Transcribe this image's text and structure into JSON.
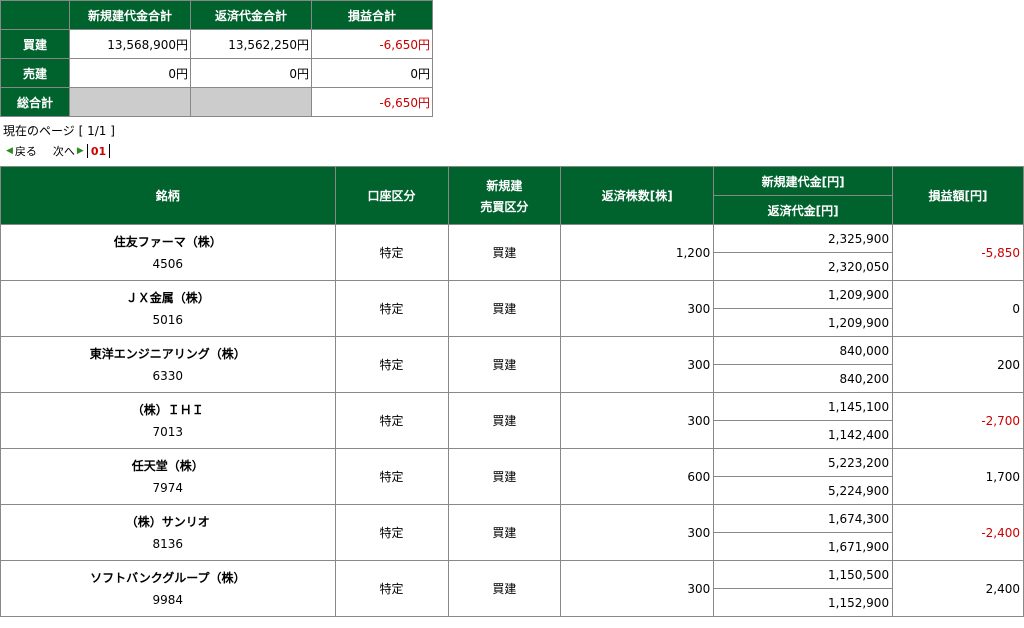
{
  "summary": {
    "headers": [
      "新規建代金合計",
      "返済代金合計",
      "損益合計"
    ],
    "rows": [
      {
        "label": "買建",
        "new_total": "13,568,900円",
        "close_total": "13,562,250円",
        "pl": "-6,650円",
        "pl_negative": true
      },
      {
        "label": "売建",
        "new_total": "0円",
        "close_total": "0円",
        "pl": "0円",
        "pl_negative": false
      },
      {
        "label": "総合計",
        "new_total": "",
        "close_total": "",
        "pl": "-6,650円",
        "pl_negative": true
      }
    ]
  },
  "page_info": "現在のページ [ 1/1 ]",
  "pager": {
    "prev_label": "戻る",
    "next_label": "次へ",
    "current_page": "01"
  },
  "table": {
    "headers": {
      "stock": "銘柄",
      "account": "口座区分",
      "trade_type_line1": "新規建",
      "trade_type_line2": "売買区分",
      "shares": "返済株数[株]",
      "new_amount": "新規建代金[円]",
      "close_amount": "返済代金[円]",
      "pl": "損益額[円]"
    },
    "rows": [
      {
        "name": "住友ファーマ（株）",
        "code": "4506",
        "account": "特定",
        "trade": "買建",
        "shares": "1,200",
        "new_amount": "2,325,900",
        "close_amount": "2,320,050",
        "pl": "-5,850",
        "pl_negative": true
      },
      {
        "name": "ＪＸ金属（株）",
        "code": "5016",
        "account": "特定",
        "trade": "買建",
        "shares": "300",
        "new_amount": "1,209,900",
        "close_amount": "1,209,900",
        "pl": "0",
        "pl_negative": false
      },
      {
        "name": "東洋エンジニアリング（株）",
        "code": "6330",
        "account": "特定",
        "trade": "買建",
        "shares": "300",
        "new_amount": "840,000",
        "close_amount": "840,200",
        "pl": "200",
        "pl_negative": false
      },
      {
        "name": "（株）ＩＨＩ",
        "code": "7013",
        "account": "特定",
        "trade": "買建",
        "shares": "300",
        "new_amount": "1,145,100",
        "close_amount": "1,142,400",
        "pl": "-2,700",
        "pl_negative": true
      },
      {
        "name": "任天堂（株）",
        "code": "7974",
        "account": "特定",
        "trade": "買建",
        "shares": "600",
        "new_amount": "5,223,200",
        "close_amount": "5,224,900",
        "pl": "1,700",
        "pl_negative": false
      },
      {
        "name": "（株）サンリオ",
        "code": "8136",
        "account": "特定",
        "trade": "買建",
        "shares": "300",
        "new_amount": "1,674,300",
        "close_amount": "1,671,900",
        "pl": "-2,400",
        "pl_negative": true
      },
      {
        "name": "ソフトバンクグループ（株）",
        "code": "9984",
        "account": "特定",
        "trade": "買建",
        "shares": "300",
        "new_amount": "1,150,500",
        "close_amount": "1,152,900",
        "pl": "2,400",
        "pl_negative": false
      }
    ]
  },
  "colors": {
    "header_green": "#00632d",
    "negative_red": "#cc0000",
    "gray_cell": "#cccccc"
  }
}
